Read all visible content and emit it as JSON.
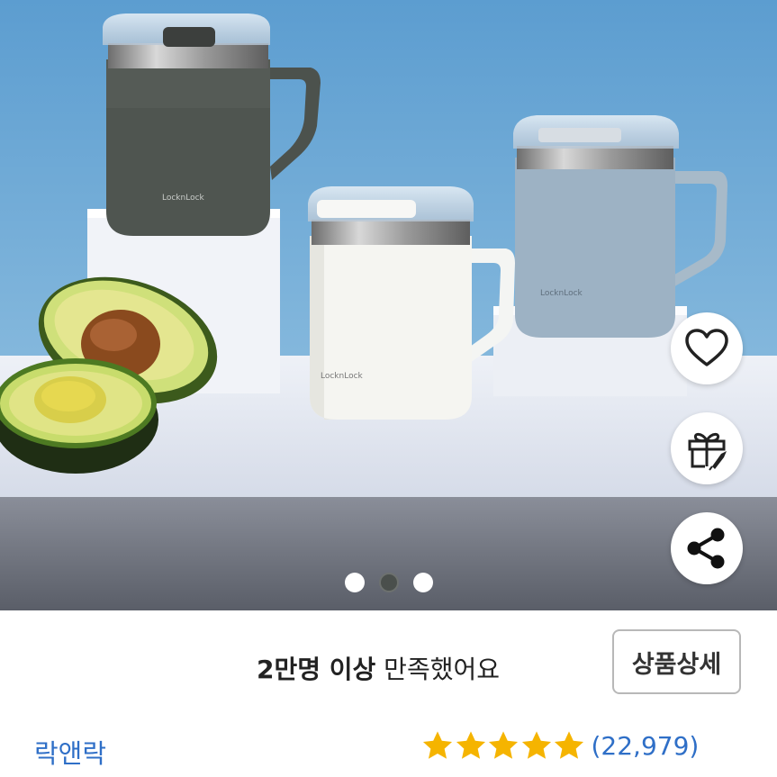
{
  "product": {
    "satisfaction_bold": "2만명 이상",
    "satisfaction_rest": " 만족했어요",
    "detail_button_label": "상품상세",
    "brand": "락앤락",
    "rating_stars": 5,
    "review_count": "(22,979)",
    "star_color": "#f5b400"
  },
  "gallery": {
    "page_count": 3,
    "active_index": 1
  },
  "mug_logo_text": "LocknLock",
  "actions": [
    "heart-icon",
    "gift-icon",
    "share-icon"
  ]
}
